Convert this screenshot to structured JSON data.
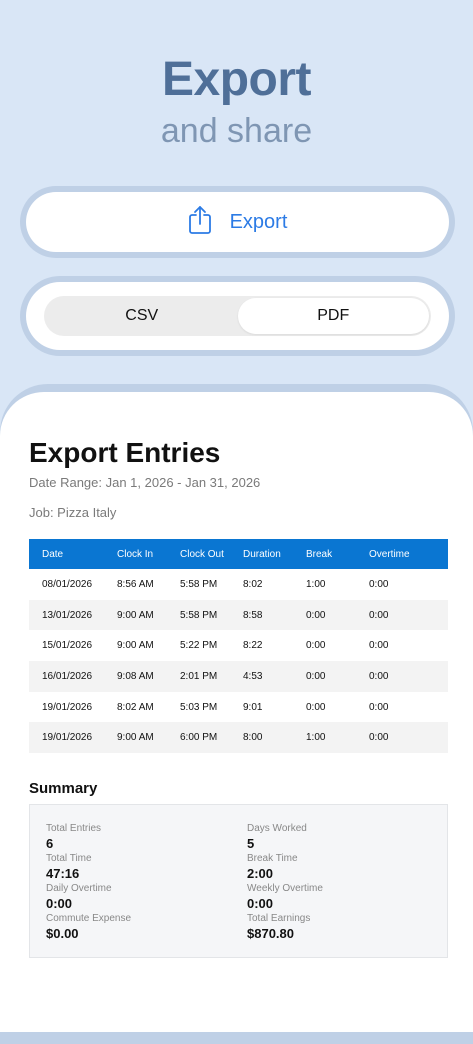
{
  "hero": {
    "title": "Export",
    "subtitle": "and share"
  },
  "export_button": {
    "label": "Export",
    "icon": "share-icon",
    "accent": "#2c7be5"
  },
  "format_toggle": {
    "options": [
      "CSV",
      "PDF"
    ],
    "selected": "PDF"
  },
  "document": {
    "title": "Export Entries",
    "date_range": "Date Range: Jan 1, 2026 - Jan 31, 2026",
    "job": "Job: Pizza Italy",
    "table": {
      "headers": [
        "Date",
        "Clock In",
        "Clock Out",
        "Duration",
        "Break",
        "Overtime"
      ],
      "rows": [
        [
          "08/01/2026",
          "8:56 AM",
          "5:58 PM",
          "8:02",
          "1:00",
          "0:00"
        ],
        [
          "13/01/2026",
          "9:00 AM",
          "5:58 PM",
          "8:58",
          "0:00",
          "0:00"
        ],
        [
          "15/01/2026",
          "9:00 AM",
          "5:22 PM",
          "8:22",
          "0:00",
          "0:00"
        ],
        [
          "16/01/2026",
          "9:08 AM",
          "2:01 PM",
          "4:53",
          "0:00",
          "0:00"
        ],
        [
          "19/01/2026",
          "8:02 AM",
          "5:03 PM",
          "9:01",
          "0:00",
          "0:00"
        ],
        [
          "19/01/2026",
          "9:00 AM",
          "6:00 PM",
          "8:00",
          "1:00",
          "0:00"
        ]
      ]
    },
    "summary": {
      "title": "Summary",
      "items": [
        {
          "label": "Total Entries",
          "value": "6"
        },
        {
          "label": "Days Worked",
          "value": "5"
        },
        {
          "label": "Total Time",
          "value": "47:16"
        },
        {
          "label": "Break Time",
          "value": "2:00"
        },
        {
          "label": "Daily Overtime",
          "value": "0:00"
        },
        {
          "label": "Weekly Overtime",
          "value": "0:00"
        },
        {
          "label": "Commute Expense",
          "value": "$0.00"
        },
        {
          "label": "Total Earnings",
          "value": "$870.80"
        }
      ]
    }
  },
  "colors": {
    "background": "#d9e6f6",
    "header_blue": "#0a76d2",
    "title": "#4f6f98"
  }
}
